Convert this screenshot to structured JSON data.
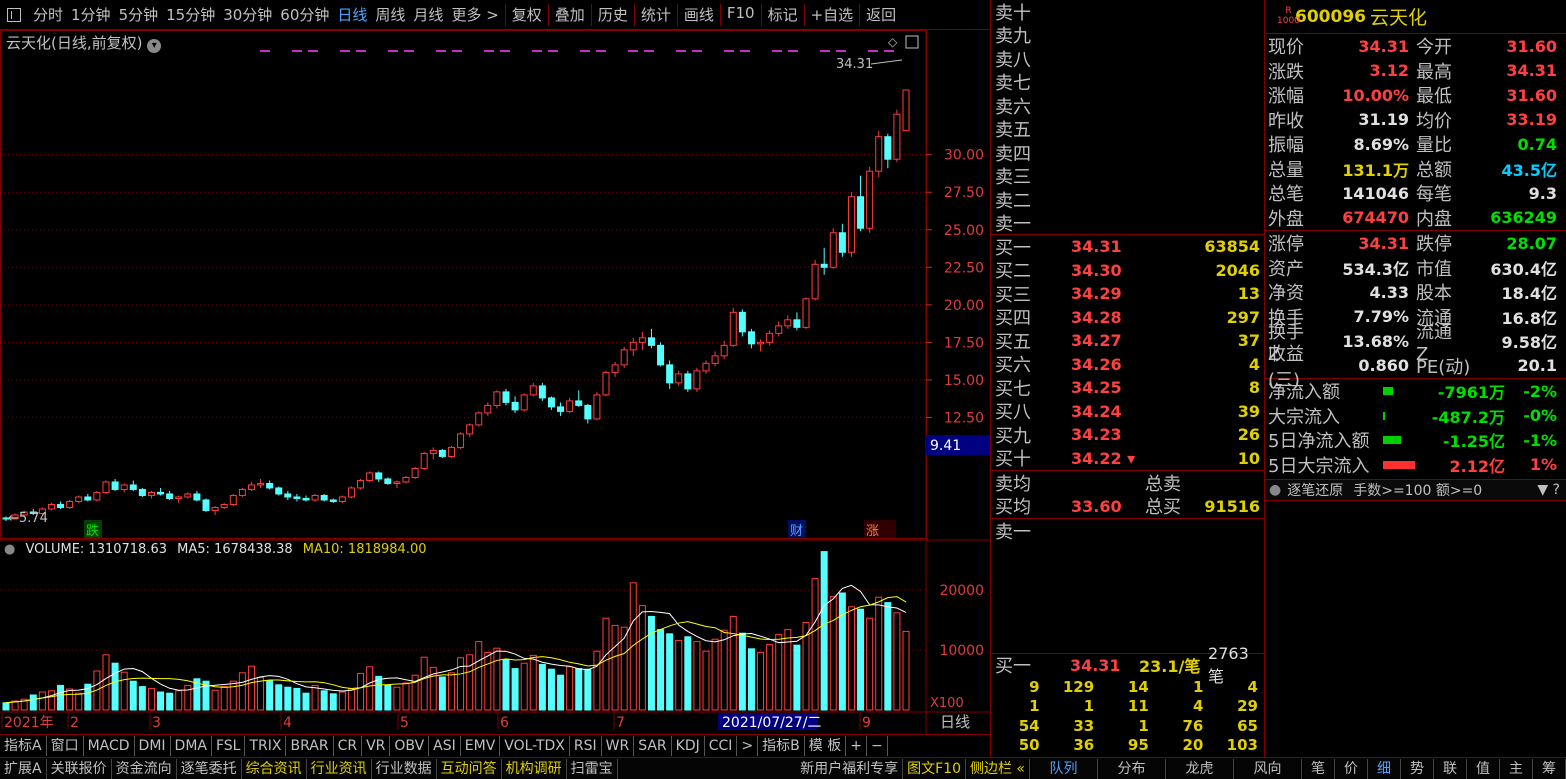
{
  "toolbar": {
    "periods": [
      "分时",
      "1分钟",
      "5分钟",
      "15分钟",
      "30分钟",
      "60分钟",
      "日线",
      "周线",
      "月线",
      "更多 >"
    ],
    "active": "日线",
    "actions": [
      "复权",
      "叠加",
      "历史",
      "统计",
      "画线",
      "F10",
      "标记",
      "+自选",
      "返回"
    ]
  },
  "chart": {
    "title": "云天化(日线,前复权)",
    "current_price_label": "34.31",
    "low_label": "5.74",
    "cursor_value": "9.41",
    "y_ticks": [
      "30.00",
      "27.50",
      "25.00",
      "22.50",
      "20.00",
      "17.50",
      "15.00",
      "12.50"
    ],
    "marker_die": "跌",
    "marker_cai": "财",
    "marker_zhang": "涨",
    "marker_zhang_prefix": "",
    "colors": {
      "up": "#ff3c3c",
      "down": "#54ffff",
      "grid": "#800000",
      "ma5": "#ffffff",
      "ma10": "#ffff00"
    }
  },
  "volume": {
    "label": "VOLUME: 1310718.63",
    "ma5": "MA5: 1678438.38",
    "ma10": "MA10: 1818984.00",
    "y_ticks": [
      "20000",
      "10000"
    ],
    "unit": "X100"
  },
  "time_axis": {
    "labels": [
      "2021年",
      "2",
      "3",
      "4",
      "5",
      "6",
      "7",
      "8",
      "9"
    ],
    "cursor_date": "2021/07/27/二",
    "period": "日线"
  },
  "chart_data": {
    "type": "candlestick",
    "y_range": [
      5,
      35
    ],
    "volume_range": [
      0,
      28000
    ],
    "candles": [
      [
        5.8,
        5.9,
        5.6,
        5.74
      ],
      [
        5.74,
        6.1,
        5.7,
        6.0
      ],
      [
        6.0,
        6.3,
        5.9,
        6.2
      ],
      [
        6.2,
        6.4,
        6.0,
        6.1
      ],
      [
        6.1,
        6.5,
        6.0,
        6.4
      ],
      [
        6.4,
        6.8,
        6.3,
        6.7
      ],
      [
        6.7,
        6.9,
        6.4,
        6.5
      ],
      [
        6.5,
        7.0,
        6.4,
        6.9
      ],
      [
        6.9,
        7.3,
        6.8,
        7.2
      ],
      [
        7.2,
        7.4,
        6.9,
        7.0
      ],
      [
        7.0,
        7.6,
        6.9,
        7.5
      ],
      [
        7.5,
        8.3,
        7.4,
        8.2
      ],
      [
        8.2,
        8.4,
        7.6,
        7.7
      ],
      [
        7.7,
        8.1,
        7.5,
        8.0
      ],
      [
        8.0,
        8.3,
        7.6,
        7.7
      ],
      [
        7.7,
        7.8,
        7.2,
        7.3
      ],
      [
        7.3,
        7.6,
        7.1,
        7.5
      ],
      [
        7.5,
        7.8,
        7.3,
        7.4
      ],
      [
        7.4,
        7.6,
        7.0,
        7.1
      ],
      [
        7.1,
        7.3,
        6.8,
        7.2
      ],
      [
        7.2,
        7.5,
        7.1,
        7.4
      ],
      [
        7.4,
        7.6,
        6.9,
        7.0
      ],
      [
        7.0,
        7.1,
        6.2,
        6.3
      ],
      [
        6.3,
        6.6,
        6.0,
        6.5
      ],
      [
        6.5,
        6.8,
        6.4,
        6.7
      ],
      [
        6.7,
        7.4,
        6.6,
        7.3
      ],
      [
        7.3,
        7.8,
        7.2,
        7.7
      ],
      [
        7.7,
        8.2,
        7.6,
        8.0
      ],
      [
        8.0,
        8.4,
        7.8,
        8.1
      ],
      [
        8.1,
        8.3,
        7.7,
        7.8
      ],
      [
        7.8,
        7.9,
        7.3,
        7.4
      ],
      [
        7.4,
        7.6,
        7.0,
        7.2
      ],
      [
        7.2,
        7.4,
        6.9,
        7.1
      ],
      [
        7.1,
        7.3,
        6.9,
        7.0
      ],
      [
        7.0,
        7.4,
        6.9,
        7.3
      ],
      [
        7.3,
        7.4,
        6.9,
        7.0
      ],
      [
        7.0,
        7.1,
        6.8,
        6.9
      ],
      [
        6.9,
        7.3,
        6.8,
        7.2
      ],
      [
        7.2,
        7.9,
        7.1,
        7.8
      ],
      [
        7.8,
        8.4,
        7.7,
        8.3
      ],
      [
        8.3,
        8.9,
        8.2,
        8.8
      ],
      [
        8.8,
        8.9,
        8.2,
        8.4
      ],
      [
        8.4,
        8.5,
        8.0,
        8.1
      ],
      [
        8.1,
        8.3,
        7.8,
        8.2
      ],
      [
        8.2,
        8.6,
        8.1,
        8.5
      ],
      [
        8.5,
        9.2,
        8.4,
        9.1
      ],
      [
        9.1,
        10.2,
        9.0,
        10.1
      ],
      [
        10.1,
        10.5,
        9.7,
        10.3
      ],
      [
        10.3,
        10.4,
        9.8,
        9.9
      ],
      [
        9.9,
        10.6,
        9.8,
        10.5
      ],
      [
        10.5,
        11.5,
        10.4,
        11.4
      ],
      [
        11.4,
        12.1,
        11.2,
        12.0
      ],
      [
        12.0,
        12.9,
        11.9,
        12.8
      ],
      [
        12.8,
        13.5,
        12.6,
        13.3
      ],
      [
        13.3,
        14.3,
        13.1,
        14.2
      ],
      [
        14.2,
        14.4,
        13.3,
        13.5
      ],
      [
        13.5,
        13.9,
        12.8,
        13.0
      ],
      [
        13.0,
        14.1,
        12.9,
        14.0
      ],
      [
        14.0,
        14.8,
        13.9,
        14.6
      ],
      [
        14.6,
        14.8,
        13.6,
        13.8
      ],
      [
        13.8,
        13.9,
        13.0,
        13.2
      ],
      [
        13.2,
        13.5,
        12.6,
        12.9
      ],
      [
        12.9,
        13.8,
        12.8,
        13.6
      ],
      [
        13.6,
        14.3,
        13.2,
        13.3
      ],
      [
        13.3,
        13.4,
        12.1,
        12.4
      ],
      [
        12.4,
        14.2,
        12.3,
        14.0
      ],
      [
        14.0,
        15.6,
        13.9,
        15.5
      ],
      [
        15.5,
        16.2,
        15.2,
        16.0
      ],
      [
        16.0,
        17.2,
        15.8,
        17.0
      ],
      [
        17.0,
        17.8,
        16.6,
        17.5
      ],
      [
        17.5,
        18.2,
        17.0,
        17.8
      ],
      [
        17.8,
        18.4,
        17.1,
        17.3
      ],
      [
        17.3,
        17.5,
        15.9,
        16.0
      ],
      [
        16.0,
        16.3,
        14.4,
        14.8
      ],
      [
        14.8,
        15.6,
        14.6,
        15.4
      ],
      [
        15.4,
        15.6,
        14.2,
        14.4
      ],
      [
        14.4,
        15.8,
        14.2,
        15.6
      ],
      [
        15.6,
        16.3,
        15.4,
        16.1
      ],
      [
        16.1,
        16.9,
        15.9,
        16.6
      ],
      [
        16.6,
        17.6,
        16.4,
        17.3
      ],
      [
        17.3,
        19.8,
        17.2,
        19.5
      ],
      [
        19.5,
        19.7,
        17.9,
        18.2
      ],
      [
        18.2,
        18.4,
        17.1,
        17.4
      ],
      [
        17.4,
        17.7,
        16.9,
        17.5
      ],
      [
        17.5,
        18.3,
        17.3,
        18.1
      ],
      [
        18.1,
        18.9,
        17.9,
        18.6
      ],
      [
        18.6,
        19.3,
        18.4,
        19.0
      ],
      [
        19.0,
        19.5,
        18.3,
        18.5
      ],
      [
        18.5,
        20.5,
        18.4,
        20.4
      ],
      [
        20.4,
        23.0,
        20.3,
        22.7
      ],
      [
        22.7,
        23.8,
        22.0,
        22.5
      ],
      [
        22.5,
        25.1,
        22.4,
        24.8
      ],
      [
        24.8,
        25.4,
        23.2,
        23.5
      ],
      [
        23.5,
        27.5,
        23.2,
        27.2
      ],
      [
        27.2,
        28.6,
        24.9,
        25.1
      ],
      [
        25.1,
        29.2,
        24.8,
        28.9
      ],
      [
        28.9,
        31.6,
        28.5,
        31.2
      ],
      [
        31.2,
        31.4,
        29.1,
        29.7
      ],
      [
        29.7,
        33.0,
        29.5,
        32.7
      ],
      [
        31.6,
        34.31,
        31.6,
        34.31
      ]
    ],
    "volumes": [
      1200,
      1500,
      1800,
      2500,
      3000,
      3200,
      4100,
      3500,
      2800,
      4300,
      6500,
      9200,
      7800,
      6300,
      4800,
      3900,
      3600,
      3000,
      2800,
      3200,
      4100,
      5200,
      4800,
      3300,
      3900,
      4800,
      6200,
      7300,
      5400,
      4900,
      4200,
      3800,
      3600,
      2800,
      4100,
      3200,
      2700,
      3000,
      3500,
      6100,
      7200,
      5600,
      4100,
      3800,
      4500,
      5800,
      8800,
      7100,
      5500,
      6200,
      8700,
      9200,
      11400,
      9600,
      10300,
      8400,
      6900,
      7800,
      9100,
      7600,
      6800,
      5800,
      7200,
      6900,
      6800,
      9800,
      15300,
      14100,
      13800,
      21200,
      17400,
      15600,
      13400,
      12700,
      11600,
      12200,
      11400,
      9800,
      11800,
      13300,
      15600,
      12800,
      10200,
      9600,
      10900,
      12600,
      13400,
      10800,
      14600,
      21900,
      26400,
      18900,
      19500,
      17200,
      16800,
      15300,
      18800,
      17900,
      16200,
      13100
    ],
    "date_labels": [
      "2021年",
      "2",
      "3",
      "4",
      "5",
      "6",
      "7",
      "8",
      "9"
    ]
  },
  "quote": {
    "code": "600096",
    "name": "云天化",
    "badge_r": "R",
    "badge_num": "1000",
    "stats": [
      [
        "现价",
        "34.31",
        "red",
        "今开",
        "31.60",
        "red"
      ],
      [
        "涨跌",
        "3.12",
        "red",
        "最高",
        "34.31",
        "red"
      ],
      [
        "涨幅",
        "10.00%",
        "red",
        "最低",
        "31.60",
        "red"
      ],
      [
        "昨收",
        "31.19",
        "wht",
        "均价",
        "33.19",
        "red"
      ],
      [
        "振幅",
        "8.69%",
        "wht",
        "量比",
        "0.74",
        "grn"
      ],
      [
        "总量",
        "131.1万",
        "yel",
        "总额",
        "43.5亿",
        "cyan"
      ],
      [
        "总笔",
        "141046",
        "wht",
        "每笔",
        "9.3",
        "wht"
      ],
      [
        "外盘",
        "674470",
        "red",
        "内盘",
        "636249",
        "grn"
      ]
    ],
    "fundamentals": [
      [
        "涨停",
        "34.31",
        "red",
        "跌停",
        "28.07",
        "grn"
      ],
      [
        "资产",
        "534.3亿",
        "wht",
        "市值",
        "630.4亿",
        "wht"
      ],
      [
        "净资",
        "4.33",
        "wht",
        "股本",
        "18.4亿",
        "wht"
      ],
      [
        "换手",
        "7.79%",
        "wht",
        "流通",
        "16.8亿",
        "wht"
      ],
      [
        "换手Z",
        "13.68%",
        "wht",
        "流通Z",
        "9.58亿",
        "wht"
      ],
      [
        "收益(三)",
        "0.860",
        "wht",
        "PE(动)",
        "20.1",
        "wht"
      ]
    ],
    "flows": [
      [
        "净流入额",
        "-7961万",
        "-2%",
        "grn",
        10
      ],
      [
        "大宗流入",
        "-487.2万",
        "-0%",
        "grn",
        2
      ],
      [
        "5日净流入额",
        "-1.25亿",
        "-1%",
        "grn",
        18
      ],
      [
        "5日大宗流入",
        "2.12亿",
        "1%",
        "red",
        32
      ]
    ],
    "tick_header": {
      "title": "逐笔还原",
      "filter": "手数>=100 额>=0"
    }
  },
  "orderbook": {
    "sells": [
      "卖十",
      "卖九",
      "卖八",
      "卖七",
      "卖六",
      "卖五",
      "卖四",
      "卖三",
      "卖二",
      "卖一"
    ],
    "buys": [
      [
        "买一",
        "34.31",
        "63854"
      ],
      [
        "买二",
        "34.30",
        "2046"
      ],
      [
        "买三",
        "34.29",
        "13"
      ],
      [
        "买四",
        "34.28",
        "297"
      ],
      [
        "买五",
        "34.27",
        "37"
      ],
      [
        "买六",
        "34.26",
        "4"
      ],
      [
        "买七",
        "34.25",
        "8"
      ],
      [
        "买八",
        "34.24",
        "39"
      ],
      [
        "买九",
        "34.23",
        "26"
      ],
      [
        "买十",
        "34.22",
        "10"
      ]
    ],
    "avg_sell_label": "卖均",
    "total_sell_label": "总卖",
    "avg_buy_label": "买均",
    "avg_buy": "33.60",
    "total_buy_label": "总买",
    "total_buy": "91516",
    "queue_sell_label": "卖一",
    "queue_buy_label": "买一",
    "queue_buy_price": "34.31",
    "queue_per": "23.1/笔",
    "queue_count": "2763笔",
    "queue_rows": [
      [
        "9",
        "129",
        "14",
        "1",
        "4"
      ],
      [
        "1",
        "1",
        "11",
        "4",
        "29"
      ],
      [
        "54",
        "33",
        "1",
        "76",
        "65"
      ],
      [
        "50",
        "36",
        "95",
        "20",
        "103"
      ]
    ]
  },
  "index_tabs": [
    "指标A",
    "窗口",
    "MACD",
    "DMI",
    "DMA",
    "FSL",
    "TRIX",
    "BRAR",
    "CR",
    "VR",
    "OBV",
    "ASI",
    "EMV",
    "VOL-TDX",
    "RSI",
    "WR",
    "SAR",
    "KDJ",
    "CCI",
    ">",
    "指标B",
    "模 板",
    "+",
    "−"
  ],
  "bottom_tabs": [
    "扩展A",
    "关联报价",
    "资金流向",
    "逐笔委托",
    "综合资讯",
    "行业资讯",
    "行业数据",
    "互动问答",
    "机构调研",
    "扫雷宝"
  ],
  "bottom_tabs_yellow": [
    "综合资讯",
    "行业资讯",
    "互动问答",
    "机构调研"
  ],
  "bottom_right": [
    "新用户福利专享",
    "图文F10",
    "侧边栏 «"
  ],
  "bottom_mid": [
    "队列",
    "分布",
    "龙虎",
    "风向"
  ],
  "bottom_far": [
    "笔",
    "价",
    "细",
    "势",
    "联",
    "值",
    "主",
    "筹"
  ]
}
